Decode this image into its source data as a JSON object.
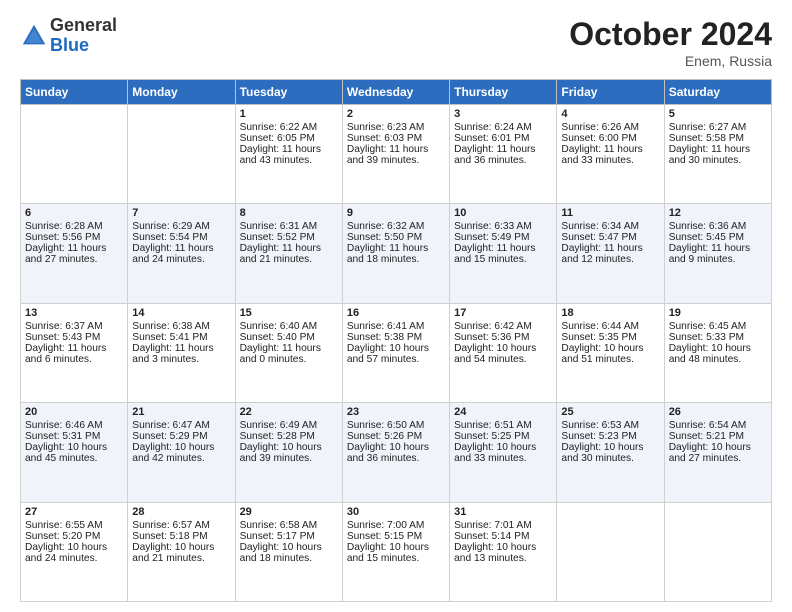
{
  "header": {
    "logo_general": "General",
    "logo_blue": "Blue",
    "month_title": "October 2024",
    "location": "Enem, Russia"
  },
  "weekdays": [
    "Sunday",
    "Monday",
    "Tuesday",
    "Wednesday",
    "Thursday",
    "Friday",
    "Saturday"
  ],
  "weeks": [
    [
      {
        "day": "",
        "sunrise": "",
        "sunset": "",
        "daylight": ""
      },
      {
        "day": "",
        "sunrise": "",
        "sunset": "",
        "daylight": ""
      },
      {
        "day": "1",
        "sunrise": "Sunrise: 6:22 AM",
        "sunset": "Sunset: 6:05 PM",
        "daylight": "Daylight: 11 hours and 43 minutes."
      },
      {
        "day": "2",
        "sunrise": "Sunrise: 6:23 AM",
        "sunset": "Sunset: 6:03 PM",
        "daylight": "Daylight: 11 hours and 39 minutes."
      },
      {
        "day": "3",
        "sunrise": "Sunrise: 6:24 AM",
        "sunset": "Sunset: 6:01 PM",
        "daylight": "Daylight: 11 hours and 36 minutes."
      },
      {
        "day": "4",
        "sunrise": "Sunrise: 6:26 AM",
        "sunset": "Sunset: 6:00 PM",
        "daylight": "Daylight: 11 hours and 33 minutes."
      },
      {
        "day": "5",
        "sunrise": "Sunrise: 6:27 AM",
        "sunset": "Sunset: 5:58 PM",
        "daylight": "Daylight: 11 hours and 30 minutes."
      }
    ],
    [
      {
        "day": "6",
        "sunrise": "Sunrise: 6:28 AM",
        "sunset": "Sunset: 5:56 PM",
        "daylight": "Daylight: 11 hours and 27 minutes."
      },
      {
        "day": "7",
        "sunrise": "Sunrise: 6:29 AM",
        "sunset": "Sunset: 5:54 PM",
        "daylight": "Daylight: 11 hours and 24 minutes."
      },
      {
        "day": "8",
        "sunrise": "Sunrise: 6:31 AM",
        "sunset": "Sunset: 5:52 PM",
        "daylight": "Daylight: 11 hours and 21 minutes."
      },
      {
        "day": "9",
        "sunrise": "Sunrise: 6:32 AM",
        "sunset": "Sunset: 5:50 PM",
        "daylight": "Daylight: 11 hours and 18 minutes."
      },
      {
        "day": "10",
        "sunrise": "Sunrise: 6:33 AM",
        "sunset": "Sunset: 5:49 PM",
        "daylight": "Daylight: 11 hours and 15 minutes."
      },
      {
        "day": "11",
        "sunrise": "Sunrise: 6:34 AM",
        "sunset": "Sunset: 5:47 PM",
        "daylight": "Daylight: 11 hours and 12 minutes."
      },
      {
        "day": "12",
        "sunrise": "Sunrise: 6:36 AM",
        "sunset": "Sunset: 5:45 PM",
        "daylight": "Daylight: 11 hours and 9 minutes."
      }
    ],
    [
      {
        "day": "13",
        "sunrise": "Sunrise: 6:37 AM",
        "sunset": "Sunset: 5:43 PM",
        "daylight": "Daylight: 11 hours and 6 minutes."
      },
      {
        "day": "14",
        "sunrise": "Sunrise: 6:38 AM",
        "sunset": "Sunset: 5:41 PM",
        "daylight": "Daylight: 11 hours and 3 minutes."
      },
      {
        "day": "15",
        "sunrise": "Sunrise: 6:40 AM",
        "sunset": "Sunset: 5:40 PM",
        "daylight": "Daylight: 11 hours and 0 minutes."
      },
      {
        "day": "16",
        "sunrise": "Sunrise: 6:41 AM",
        "sunset": "Sunset: 5:38 PM",
        "daylight": "Daylight: 10 hours and 57 minutes."
      },
      {
        "day": "17",
        "sunrise": "Sunrise: 6:42 AM",
        "sunset": "Sunset: 5:36 PM",
        "daylight": "Daylight: 10 hours and 54 minutes."
      },
      {
        "day": "18",
        "sunrise": "Sunrise: 6:44 AM",
        "sunset": "Sunset: 5:35 PM",
        "daylight": "Daylight: 10 hours and 51 minutes."
      },
      {
        "day": "19",
        "sunrise": "Sunrise: 6:45 AM",
        "sunset": "Sunset: 5:33 PM",
        "daylight": "Daylight: 10 hours and 48 minutes."
      }
    ],
    [
      {
        "day": "20",
        "sunrise": "Sunrise: 6:46 AM",
        "sunset": "Sunset: 5:31 PM",
        "daylight": "Daylight: 10 hours and 45 minutes."
      },
      {
        "day": "21",
        "sunrise": "Sunrise: 6:47 AM",
        "sunset": "Sunset: 5:29 PM",
        "daylight": "Daylight: 10 hours and 42 minutes."
      },
      {
        "day": "22",
        "sunrise": "Sunrise: 6:49 AM",
        "sunset": "Sunset: 5:28 PM",
        "daylight": "Daylight: 10 hours and 39 minutes."
      },
      {
        "day": "23",
        "sunrise": "Sunrise: 6:50 AM",
        "sunset": "Sunset: 5:26 PM",
        "daylight": "Daylight: 10 hours and 36 minutes."
      },
      {
        "day": "24",
        "sunrise": "Sunrise: 6:51 AM",
        "sunset": "Sunset: 5:25 PM",
        "daylight": "Daylight: 10 hours and 33 minutes."
      },
      {
        "day": "25",
        "sunrise": "Sunrise: 6:53 AM",
        "sunset": "Sunset: 5:23 PM",
        "daylight": "Daylight: 10 hours and 30 minutes."
      },
      {
        "day": "26",
        "sunrise": "Sunrise: 6:54 AM",
        "sunset": "Sunset: 5:21 PM",
        "daylight": "Daylight: 10 hours and 27 minutes."
      }
    ],
    [
      {
        "day": "27",
        "sunrise": "Sunrise: 6:55 AM",
        "sunset": "Sunset: 5:20 PM",
        "daylight": "Daylight: 10 hours and 24 minutes."
      },
      {
        "day": "28",
        "sunrise": "Sunrise: 6:57 AM",
        "sunset": "Sunset: 5:18 PM",
        "daylight": "Daylight: 10 hours and 21 minutes."
      },
      {
        "day": "29",
        "sunrise": "Sunrise: 6:58 AM",
        "sunset": "Sunset: 5:17 PM",
        "daylight": "Daylight: 10 hours and 18 minutes."
      },
      {
        "day": "30",
        "sunrise": "Sunrise: 7:00 AM",
        "sunset": "Sunset: 5:15 PM",
        "daylight": "Daylight: 10 hours and 15 minutes."
      },
      {
        "day": "31",
        "sunrise": "Sunrise: 7:01 AM",
        "sunset": "Sunset: 5:14 PM",
        "daylight": "Daylight: 10 hours and 13 minutes."
      },
      {
        "day": "",
        "sunrise": "",
        "sunset": "",
        "daylight": ""
      },
      {
        "day": "",
        "sunrise": "",
        "sunset": "",
        "daylight": ""
      }
    ]
  ]
}
